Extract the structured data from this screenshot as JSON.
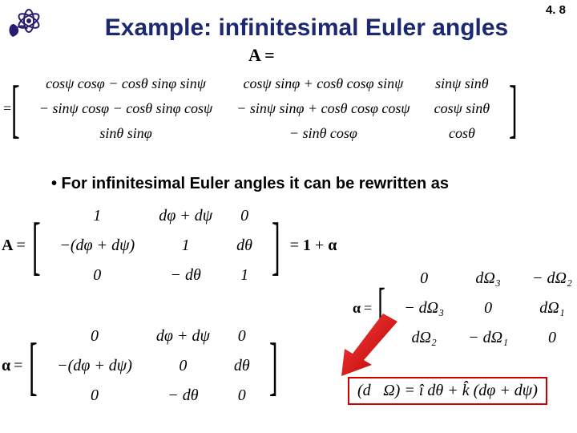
{
  "page_number": "4. 8",
  "title": "Example: infinitesimal Euler angles",
  "eq_A_equals": "A =",
  "matrix_full": {
    "r1c1": "cosψ cosφ − cosθ sinφ sinψ",
    "r1c2": "cosψ sinφ + cosθ cosφ sinψ",
    "r1c3": "sinψ sinθ",
    "r2c1": "− sinψ cosφ − cosθ sinφ cosψ",
    "r2c2": "− sinψ sinφ + cosθ cosφ cosψ",
    "r2c3": "cosψ sinθ",
    "r3c1": "sinθ sinφ",
    "r3c2": "− sinθ cosφ",
    "r3c3": "cosθ"
  },
  "bullet": "• For infinitesimal Euler angles it can be rewritten as",
  "A_label": "A",
  "eq_sign": "=",
  "matrix_small": {
    "r1c1": "1",
    "r1c2": "dφ + dψ",
    "r1c3": "0",
    "r2c1": "−(dφ + dψ)",
    "r2c2": "1",
    "r2c3": "dθ",
    "r3c1": "0",
    "r3c2": "− dθ",
    "r3c3": "1"
  },
  "rhs_identity": "= 1 + α",
  "alpha_label": "α",
  "matrix_alpha": {
    "r1c1": "0",
    "r1c2": "dφ + dψ",
    "r1c3": "0",
    "r2c1": "−(dφ + dψ)",
    "r2c2": "0",
    "r2c3": "dθ",
    "r3c1": "0",
    "r3c2": "− dθ",
    "r3c3": "0"
  },
  "matrix_omega": {
    "r1c1": "0",
    "r1c2": "dΩ₃",
    "r1c3": "− dΩ₂",
    "r2c1": "− dΩ₃",
    "r2c2": "0",
    "r2c3": "dΩ₁",
    "r3c1": "dΩ₂",
    "r3c2": "− dΩ₁",
    "r3c3": "0"
  },
  "boxed_eq": "(d⃗Ω) = î dθ + k̂ (dφ + dψ)"
}
